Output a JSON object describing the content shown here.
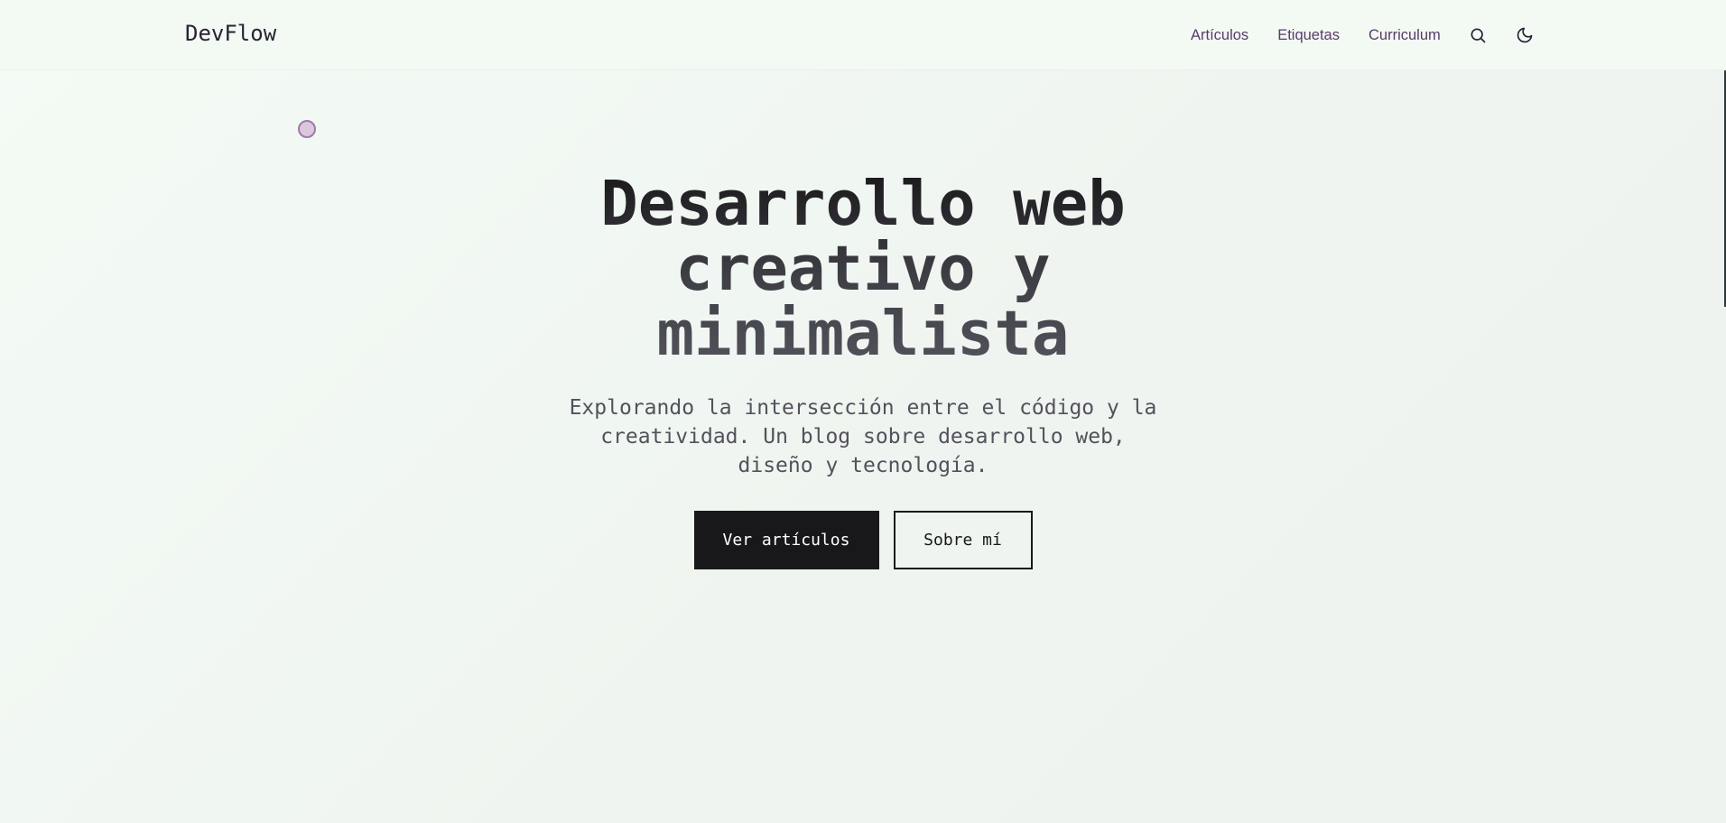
{
  "header": {
    "logo": "DevFlow",
    "nav": [
      {
        "label": "Artículos"
      },
      {
        "label": "Etiquetas"
      },
      {
        "label": "Curriculum"
      }
    ],
    "icons": {
      "search": "search-icon",
      "theme": "moon-icon"
    }
  },
  "hero": {
    "title_line1": "Desarrollo web",
    "title_line2": "creativo y",
    "title_line3": "minimalista",
    "subtitle_line1": "Explorando la intersección entre el código y la",
    "subtitle_line2": "creatividad. Un blog sobre desarrollo web,",
    "subtitle_line3": "diseño y tecnología.",
    "primary_button": "Ver artículos",
    "secondary_button": "Sobre mí"
  },
  "colors": {
    "background": "#f2faf3",
    "nav_link": "#5b3a6b",
    "primary_button_bg": "#18181b",
    "cursor_dot": "#dcc8dd"
  }
}
